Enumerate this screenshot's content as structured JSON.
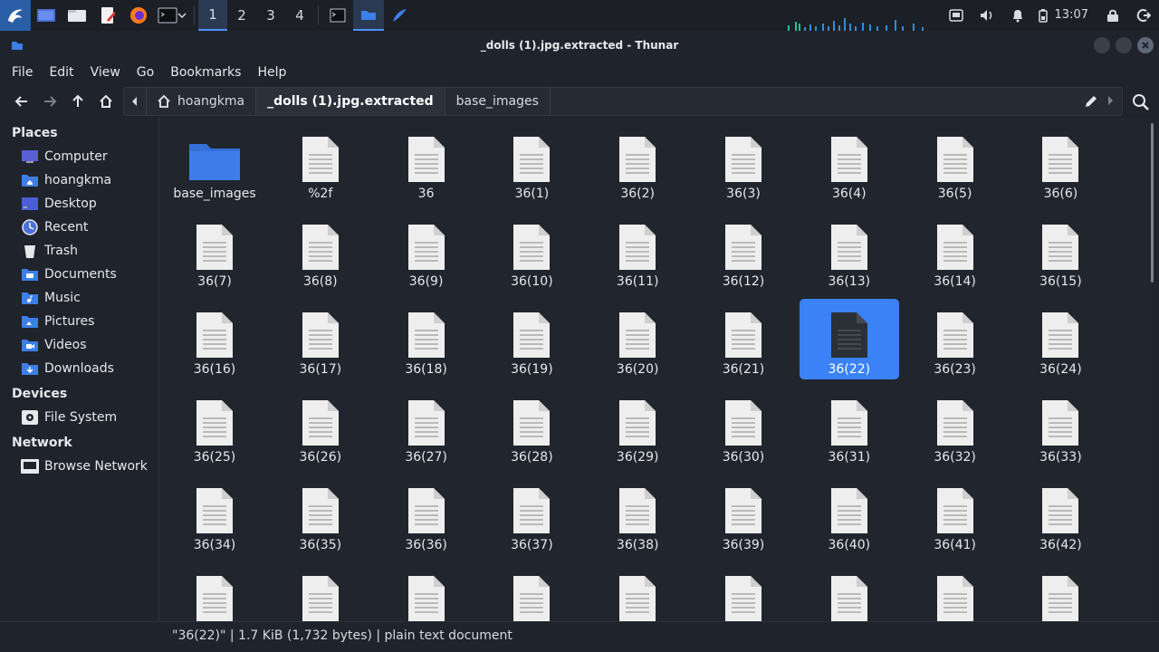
{
  "panel": {
    "workspaces": [
      "1",
      "2",
      "3",
      "4"
    ],
    "active_workspace": 0,
    "clock": "13:07"
  },
  "window": {
    "title": "_dolls (1).jpg.extracted - Thunar"
  },
  "menu": [
    "File",
    "Edit",
    "View",
    "Go",
    "Bookmarks",
    "Help"
  ],
  "pathbar": {
    "crumbs": [
      "hoangkma",
      "_dolls (1).jpg.extracted",
      "base_images"
    ],
    "active": 1
  },
  "sidebar": {
    "places_title": "Places",
    "places": [
      {
        "label": "Computer",
        "icon": "computer-icon"
      },
      {
        "label": "hoangkma",
        "icon": "home-folder-icon"
      },
      {
        "label": "Desktop",
        "icon": "desktop-icon"
      },
      {
        "label": "Recent",
        "icon": "recent-icon"
      },
      {
        "label": "Trash",
        "icon": "trash-icon"
      },
      {
        "label": "Documents",
        "icon": "documents-folder-icon"
      },
      {
        "label": "Music",
        "icon": "music-folder-icon"
      },
      {
        "label": "Pictures",
        "icon": "pictures-folder-icon"
      },
      {
        "label": "Videos",
        "icon": "videos-folder-icon"
      },
      {
        "label": "Downloads",
        "icon": "downloads-folder-icon"
      }
    ],
    "devices_title": "Devices",
    "devices": [
      {
        "label": "File System",
        "icon": "drive-icon"
      }
    ],
    "network_title": "Network",
    "network": [
      {
        "label": "Browse Network",
        "icon": "network-icon"
      }
    ]
  },
  "files": [
    {
      "name": "base_images",
      "type": "folder"
    },
    {
      "name": "%2f",
      "type": "file"
    },
    {
      "name": "36",
      "type": "file"
    },
    {
      "name": "36(1)",
      "type": "file"
    },
    {
      "name": "36(2)",
      "type": "file"
    },
    {
      "name": "36(3)",
      "type": "file"
    },
    {
      "name": "36(4)",
      "type": "file"
    },
    {
      "name": "36(5)",
      "type": "file"
    },
    {
      "name": "36(6)",
      "type": "file"
    },
    {
      "name": "36(7)",
      "type": "file"
    },
    {
      "name": "36(8)",
      "type": "file"
    },
    {
      "name": "36(9)",
      "type": "file"
    },
    {
      "name": "36(10)",
      "type": "file"
    },
    {
      "name": "36(11)",
      "type": "file"
    },
    {
      "name": "36(12)",
      "type": "file"
    },
    {
      "name": "36(13)",
      "type": "file"
    },
    {
      "name": "36(14)",
      "type": "file"
    },
    {
      "name": "36(15)",
      "type": "file"
    },
    {
      "name": "36(16)",
      "type": "file"
    },
    {
      "name": "36(17)",
      "type": "file"
    },
    {
      "name": "36(18)",
      "type": "file"
    },
    {
      "name": "36(19)",
      "type": "file"
    },
    {
      "name": "36(20)",
      "type": "file"
    },
    {
      "name": "36(21)",
      "type": "file"
    },
    {
      "name": "36(22)",
      "type": "file",
      "selected": true
    },
    {
      "name": "36(23)",
      "type": "file"
    },
    {
      "name": "36(24)",
      "type": "file"
    },
    {
      "name": "36(25)",
      "type": "file"
    },
    {
      "name": "36(26)",
      "type": "file"
    },
    {
      "name": "36(27)",
      "type": "file"
    },
    {
      "name": "36(28)",
      "type": "file"
    },
    {
      "name": "36(29)",
      "type": "file"
    },
    {
      "name": "36(30)",
      "type": "file"
    },
    {
      "name": "36(31)",
      "type": "file"
    },
    {
      "name": "36(32)",
      "type": "file"
    },
    {
      "name": "36(33)",
      "type": "file"
    },
    {
      "name": "36(34)",
      "type": "file"
    },
    {
      "name": "36(35)",
      "type": "file"
    },
    {
      "name": "36(36)",
      "type": "file"
    },
    {
      "name": "36(37)",
      "type": "file"
    },
    {
      "name": "36(38)",
      "type": "file"
    },
    {
      "name": "36(39)",
      "type": "file"
    },
    {
      "name": "36(40)",
      "type": "file"
    },
    {
      "name": "36(41)",
      "type": "file"
    },
    {
      "name": "36(42)",
      "type": "file"
    },
    {
      "name": "",
      "type": "file"
    },
    {
      "name": "",
      "type": "file"
    },
    {
      "name": "",
      "type": "file"
    },
    {
      "name": "",
      "type": "file"
    },
    {
      "name": "",
      "type": "file"
    },
    {
      "name": "",
      "type": "file"
    },
    {
      "name": "",
      "type": "file"
    },
    {
      "name": "",
      "type": "file"
    },
    {
      "name": "",
      "type": "file"
    }
  ],
  "status": "\"36(22)\" | 1.7 KiB (1,732 bytes) | plain text document",
  "colors": {
    "accent": "#3a82f6",
    "folder": "#3d7ee8",
    "background": "#21252d"
  }
}
